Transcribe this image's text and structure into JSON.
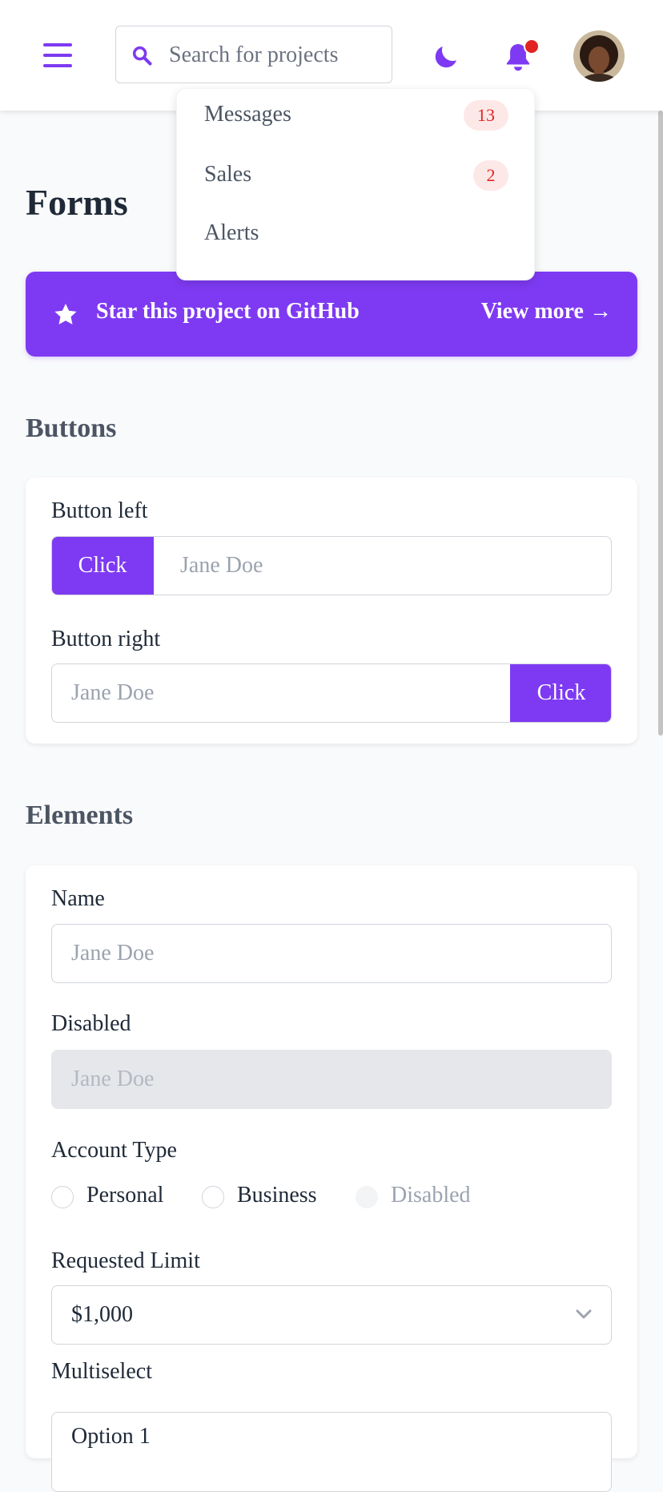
{
  "header": {
    "search_placeholder": "Search for projects",
    "accent": "#7e3af2"
  },
  "notifications": {
    "items": [
      {
        "label": "Messages",
        "count": "13"
      },
      {
        "label": "Sales",
        "count": "2"
      },
      {
        "label": "Alerts"
      }
    ]
  },
  "page": {
    "title": "Forms",
    "banner_text": "Star this project on GitHub",
    "banner_link": "View more →"
  },
  "buttons_section": {
    "title": "Buttons",
    "left_label": "Button left",
    "left_button": "Click",
    "left_placeholder": "Jane Doe",
    "right_label": "Button right",
    "right_button": "Click",
    "right_placeholder": "Jane Doe"
  },
  "elements_section": {
    "title": "Elements",
    "name_label": "Name",
    "name_placeholder": "Jane Doe",
    "disabled_label": "Disabled",
    "disabled_placeholder": "Jane Doe",
    "account_label": "Account Type",
    "account_options": [
      "Personal",
      "Business",
      "Disabled"
    ],
    "limit_label": "Requested Limit",
    "limit_value": "$1,000",
    "multiselect_label": "Multiselect",
    "multiselect_first": "Option 1"
  }
}
